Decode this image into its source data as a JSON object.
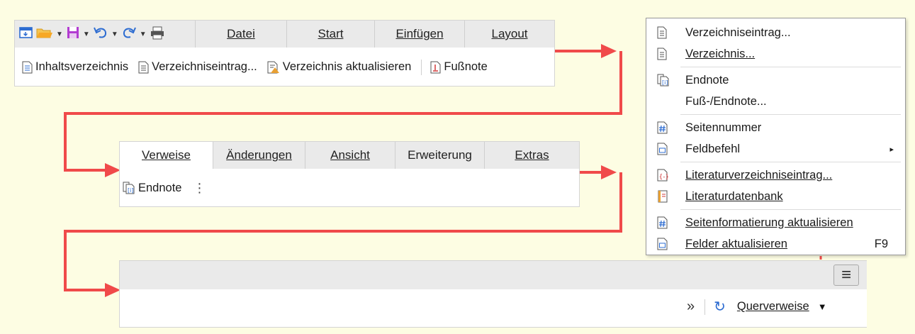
{
  "colors": {
    "background": "#fdfde3",
    "arrow": "#f04a4a",
    "accent_blue": "#2d6cd1",
    "orange": "#e8a033",
    "purple": "#b23bd1"
  },
  "quick_access": {
    "icons": [
      "window-icon",
      "open-folder-icon",
      "save-icon",
      "undo-icon",
      "redo-icon",
      "print-icon"
    ]
  },
  "top_tabs": [
    {
      "label": "Datei",
      "underline": "D"
    },
    {
      "label": "Start",
      "underline": "S"
    },
    {
      "label": "Einfügen",
      "underline": "E"
    },
    {
      "label": "Layout",
      "underline": "L"
    }
  ],
  "top_toolbar": [
    {
      "label": "Inhaltsverzeichnis",
      "icon": "document-icon"
    },
    {
      "label": "Verzeichniseintrag...",
      "icon": "document-icon"
    },
    {
      "label": "Verzeichnis aktualisieren",
      "icon": "document-warning-icon"
    },
    {
      "label": "Fußnote",
      "icon": "footnote-icon"
    }
  ],
  "mid_tabs": [
    {
      "label": "Verweise",
      "active": true
    },
    {
      "label": "Änderungen"
    },
    {
      "label": "Ansicht"
    },
    {
      "label": "Erweiterung"
    },
    {
      "label": "Extras"
    }
  ],
  "mid_toolbar": {
    "endnote_label": "Endnote",
    "more_glyph": "⋮"
  },
  "bottom_bar": {
    "menu_glyph": "≡",
    "overflow_glyph": "»",
    "refresh_glyph": "↻",
    "crossref_label": "Querverweise",
    "dropdown_glyph": "▼"
  },
  "context_menu": [
    {
      "label": "Verzeichniseintrag...",
      "icon": "document-icon"
    },
    {
      "label": "Verzeichnis...",
      "icon": "document-icon"
    },
    {
      "label": "Endnote",
      "icon": "endnote-icon"
    },
    {
      "label": "Fuß-/Endnote...",
      "icon": ""
    },
    {
      "label": "Seitennummer",
      "icon": "page-number-icon"
    },
    {
      "label": "Feldbefehl",
      "icon": "field-icon",
      "submenu": "▸"
    },
    {
      "label": "Literaturverzeichniseintrag...",
      "icon": "bibliography-entry-icon"
    },
    {
      "label": "Literaturdatenbank",
      "icon": "bibliography-database-icon"
    },
    {
      "label": "Seitenformatierung aktualisieren",
      "icon": "page-format-icon"
    },
    {
      "label": "Felder aktualisieren",
      "icon": "update-fields-icon",
      "shortcut": "F9"
    }
  ]
}
